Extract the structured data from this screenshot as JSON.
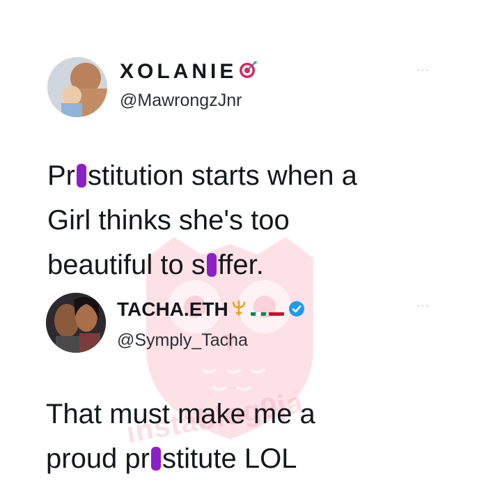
{
  "tweet1": {
    "display_name": "XOLANIE",
    "name_emoji": "target-icon",
    "handle": "@MawrongzJnr",
    "more": "···",
    "body": {
      "l1_a": "Pr",
      "l1_b": "stitution starts when a",
      "l2": "Girl thinks she's too",
      "l3_a": "beautiful to s",
      "l3_b": "ffer."
    }
  },
  "tweet2": {
    "display_name": "TACHA.ETH",
    "name_emojis": [
      "trident-icon",
      "nigeria-flag-icon",
      "ghana-flag-icon"
    ],
    "verified": true,
    "handle": "@Symply_Tacha",
    "more": "···",
    "body": {
      "l1": "That must make me a",
      "l2_a": "proud pr",
      "l2_b": "stitute LOL"
    }
  },
  "watermark": {
    "text": "instablog9ja"
  },
  "colors": {
    "censor": "#8d1fc9",
    "verified": "#1d9bf0",
    "watermark": "#f4a0b5"
  }
}
